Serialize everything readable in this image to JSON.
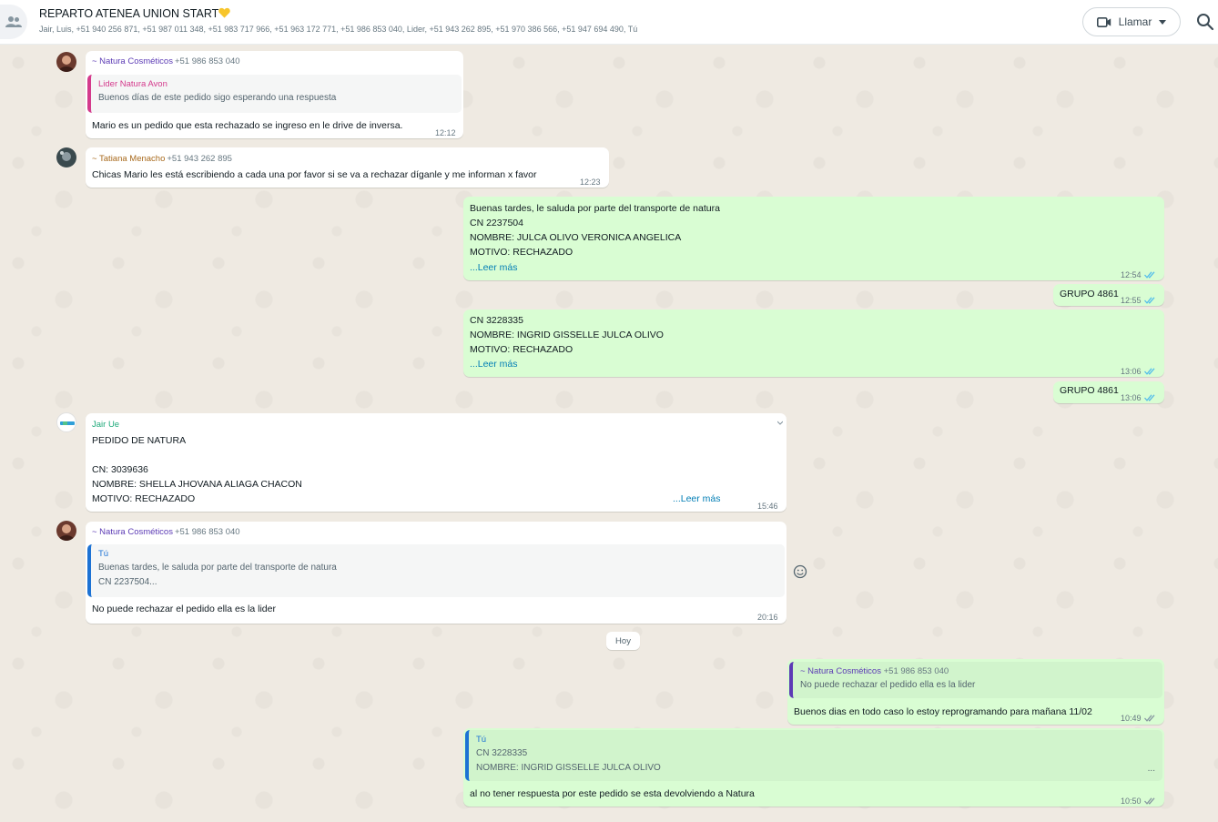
{
  "header": {
    "title": "REPARTO  ATENEA UNION START",
    "members": "Jair, Luis, +51 940 256 871, +51 987 011 348, +51 983 717 966, +51 963 172 771, +51 986 853 040, Lider, +51 943 262 895, +51 970 386 566, +51 947 694 490, Tú",
    "call_label": "Llamar"
  },
  "messages": {
    "m1": {
      "sender": "~ Natura Cosméticos",
      "phone": "+51 986 853 040",
      "quote_name": "Lider Natura Avon",
      "quote_text": "Buenos días de este pedido sigo esperando una respuesta",
      "text": "Mario es  un pedido que esta rechazado se ingreso en le drive de inversa.",
      "time": "12:12"
    },
    "m2": {
      "sender": "~ Tatiana Menacho",
      "phone": "+51 943 262 895",
      "text": "Chicas Mario les está escribiendo a cada una por favor si se va a rechazar díganle y me informan x favor",
      "time": "12:23"
    },
    "m3": {
      "lines": [
        "Buenas tardes, le saluda por parte del transporte de natura",
        "CN 2237504",
        "NOMBRE: JULCA OLIVO VERONICA ANGELICA",
        "MOTIVO: RECHAZADO"
      ],
      "read_more": "...Leer más",
      "time": "12:54"
    },
    "m4": {
      "text": "GRUPO 4861",
      "time": "12:55"
    },
    "m5": {
      "lines": [
        "CN 3228335",
        "NOMBRE: INGRID GISSELLE JULCA OLIVO",
        "MOTIVO: RECHAZADO"
      ],
      "read_more": "...Leer más",
      "time": "13:06"
    },
    "m6": {
      "text": "GRUPO 4861",
      "time": "13:06"
    },
    "m7": {
      "sender": "Jair Ue",
      "lines": [
        "PEDIDO DE NATURA",
        "",
        "CN:  3039636",
        "NOMBRE:  SHELLA JHOVANA ALIAGA CHACON",
        "MOTIVO: RECHAZADO"
      ],
      "read_more": "...Leer más",
      "time": "15:46"
    },
    "m8": {
      "sender": "~ Natura Cosméticos",
      "phone": "+51 986 853 040",
      "quote_name": "Tú",
      "quote_line1": "Buenas tardes, le saluda por parte del transporte de natura",
      "quote_line2": "CN 2237504...",
      "text": "No puede rechazar el pedido ella es la lider",
      "time": "20:16"
    },
    "date_divider": "Hoy",
    "m9": {
      "quote_name": "~ Natura Cosméticos",
      "quote_phone": "+51 986 853 040",
      "quote_text": "No puede rechazar el pedido ella es la lider",
      "text": "Buenos dias en todo caso lo estoy reprogramando para mañana 11/02",
      "time": "10:49"
    },
    "m10": {
      "quote_name": "Tú",
      "quote_line1": "CN 3228335",
      "quote_line2": "NOMBRE: INGRID GISSELLE JULCA OLIVO",
      "quote_ellipsis": "...",
      "text": "al no tener respuesta por este pedido se esta devolviendo a Natura",
      "time": "10:50"
    }
  },
  "colors": {
    "outgoing": "#d9fdd3",
    "incoming": "#ffffff",
    "natura_name": "#5c3bb5",
    "tatiana_name": "#a86a1d",
    "jair_name": "#1fa97a",
    "lider_quote": "#d43a8c",
    "tu_quote": "#1c72d4",
    "ticks": "#53bdeb"
  },
  "icons": {
    "group": "group-avatar-icon",
    "heart": "yellow-heart-icon",
    "video": "video-camera-icon",
    "search": "search-icon",
    "emoji": "emoji-reaction-icon",
    "ticks": "double-check-icon"
  }
}
